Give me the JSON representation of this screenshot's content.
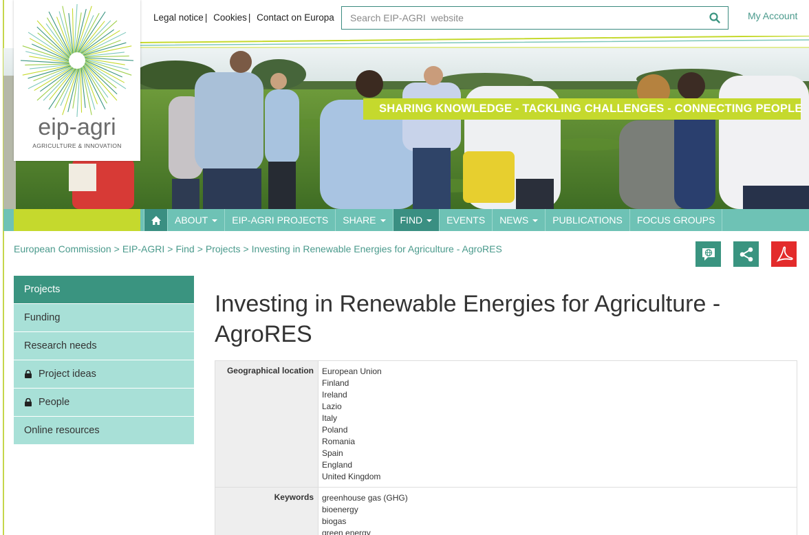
{
  "header": {
    "util_links": [
      "Legal notice",
      "Cookies",
      "Contact on Europa"
    ],
    "search_placeholder": "Search EIP-AGRI  website",
    "my_account": "My Account"
  },
  "logo": {
    "name": "eip-agri",
    "subtitle": "AGRICULTURE & INNOVATION"
  },
  "hero": {
    "tagline": "SHARING KNOWLEDGE - TACKLING CHALLENGES - CONNECTING PEOPLE"
  },
  "nav": {
    "items": [
      {
        "label": "ABOUT",
        "dropdown": true
      },
      {
        "label": "EIP-AGRI PROJECTS",
        "dropdown": false
      },
      {
        "label": "SHARE",
        "dropdown": true
      },
      {
        "label": "FIND",
        "dropdown": true,
        "active": true
      },
      {
        "label": "EVENTS",
        "dropdown": false
      },
      {
        "label": "NEWS",
        "dropdown": true
      },
      {
        "label": "PUBLICATIONS",
        "dropdown": false
      },
      {
        "label": "FOCUS GROUPS",
        "dropdown": false
      }
    ]
  },
  "breadcrumb": [
    "European Commission",
    "EIP-AGRI",
    "Find",
    "Projects",
    "Investing in Renewable Energies for Agriculture - AgroRES"
  ],
  "sidebar": {
    "items": [
      {
        "label": "Projects",
        "active": true,
        "locked": false
      },
      {
        "label": "Funding",
        "active": false,
        "locked": false
      },
      {
        "label": "Research needs",
        "active": false,
        "locked": false
      },
      {
        "label": "Project ideas",
        "active": false,
        "locked": true
      },
      {
        "label": "People",
        "active": false,
        "locked": true
      },
      {
        "label": "Online resources",
        "active": false,
        "locked": false
      }
    ]
  },
  "main": {
    "title": "Investing in Renewable Energies for Agriculture - AgroRES",
    "geo_label": "Geographical location",
    "geo_values": [
      "European Union",
      "Finland",
      "Ireland",
      "Lazio",
      "Italy",
      "Poland",
      "Romania",
      "Spain",
      "England",
      "United Kingdom"
    ],
    "keywords_label": "Keywords",
    "keywords_values": [
      "greenhouse gas (GHG)",
      "bioenergy",
      "biogas",
      "green energy"
    ]
  },
  "colors": {
    "teal": "#3a9480",
    "light_teal": "#a8e0d7",
    "nav_teal": "#6ec2b5",
    "lime": "#c5d92d",
    "pdf_red": "#e32b2b"
  }
}
